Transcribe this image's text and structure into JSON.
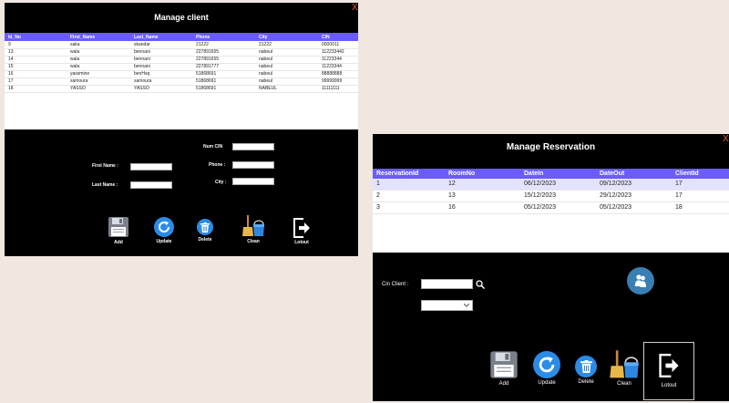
{
  "client_window": {
    "title": "Manage client",
    "close": "X",
    "columns": [
      "Id_No",
      "First_Name",
      "Last_Name",
      "Phone",
      "City",
      "CIN"
    ],
    "rows": [
      [
        "9",
        "saka",
        "skandar",
        "21222",
        "21222",
        "0000011"
      ],
      [
        "13",
        "wala",
        "bennani",
        "227891655",
        "nabeul",
        "112233442"
      ],
      [
        "14",
        "wala",
        "bennani",
        "227891655",
        "nabeul",
        "11223344"
      ],
      [
        "15",
        "wala",
        "bennani",
        "227891777",
        "nabeul",
        "11223344"
      ],
      [
        "16",
        "yassmine",
        "benHsq",
        "51868691",
        "nabeul",
        "88888888"
      ],
      [
        "17",
        "samoura",
        "samoura",
        "51868691",
        "nabeul",
        "99999999"
      ],
      [
        "18",
        "YASSO",
        "YASSO",
        "51868691",
        "NABEUL",
        "11111111"
      ]
    ],
    "form": {
      "first_name_label": "First Name :",
      "last_name_label": "Last Name :",
      "num_cin_label": "Num CIN",
      "phone_label": "Phone :",
      "city_label": "City :"
    },
    "buttons": {
      "add": "Add",
      "update": "Update",
      "delete": "Delete",
      "clean": "Clean",
      "logout": "Lotout"
    }
  },
  "reservation_window": {
    "title": "Manage Reservation",
    "close": "X",
    "columns": [
      "ReservationId",
      "RoomNo",
      "DateIn",
      "DateOut",
      "ClientId"
    ],
    "rows": [
      [
        "1",
        "12",
        "06/12/2023",
        "09/12/2023",
        "17"
      ],
      [
        "2",
        "13",
        "15/12/2023",
        "29/12/2023",
        "17"
      ],
      [
        "3",
        "16",
        "05/12/2023",
        "05/12/2023",
        "18"
      ]
    ],
    "cin_client_label": "Cin Client :",
    "buttons": {
      "add": "Add",
      "update": "Update",
      "delete": "Delete",
      "clean": "Clean",
      "logout": "Lotout"
    }
  },
  "colors": {
    "header": "#6a5cff",
    "background": "#efe7e0",
    "accent_blue": "#2a8ce6",
    "close": "#e0602c",
    "selected_row": "#e3e3ff"
  },
  "icons": {
    "add": "floppy-disk-icon",
    "update": "refresh-icon",
    "delete": "trash-icon",
    "clean": "broom-bucket-icon",
    "logout": "exit-icon",
    "search": "magnifier-icon",
    "people": "people-icon",
    "dropdown": "chevron-down-icon"
  }
}
